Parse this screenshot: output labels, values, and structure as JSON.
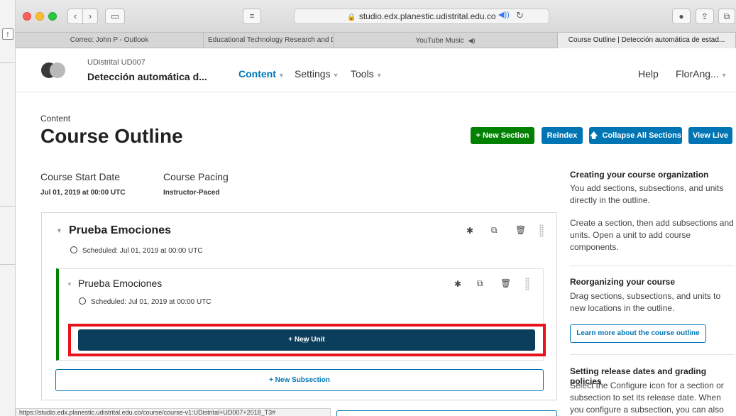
{
  "browser": {
    "url": "studio.edx.planestic.udistrital.edu.co",
    "tabs": [
      {
        "label": "Correo: John P - Outlook",
        "active": false
      },
      {
        "label": "Educational Technology Research and Developme...",
        "active": false
      },
      {
        "label": "YouTube Music",
        "active": false
      },
      {
        "label": "Course Outline | Detección automática de estad...",
        "active": true
      }
    ],
    "status_url": "https://studio.edx.planestic.udistrital.edu.co/course/course-v1:UDistrital+UD007+2018_T3#"
  },
  "header": {
    "course_org": "UDistrital UD007",
    "course_title": "Detección automática d...",
    "nav": {
      "content": "Content",
      "settings": "Settings",
      "tools": "Tools",
      "help": "Help",
      "user": "FlorAng..."
    }
  },
  "page": {
    "subtitle": "Content",
    "title": "Course Outline",
    "actions": {
      "new_section": "+ New Section",
      "reindex": "Reindex",
      "collapse_all": "Collapse All Sections",
      "view_live": "View Live"
    }
  },
  "meta": {
    "start_label": "Course Start Date",
    "start_value": "Jul 01, 2019 at 00:00 UTC",
    "pacing_label": "Course Pacing",
    "pacing_value": "Instructor-Paced"
  },
  "outline": {
    "section": {
      "title": "Prueba Emociones",
      "scheduled": "Scheduled: Jul 01, 2019 at 00:00 UTC"
    },
    "subsection": {
      "title": "Prueba Emociones",
      "scheduled": "Scheduled: Jul 01, 2019 at 00:00 UTC"
    },
    "new_unit": "+  New Unit",
    "new_subsection": "+  New Subsection"
  },
  "sidebar": {
    "h1": "Creating your course organization",
    "p1": "You add sections, subsections, and units directly in the outline.",
    "p2": "Create a section, then add subsections and units. Open a unit to add course components.",
    "h2": "Reorganizing your course",
    "p3": "Drag sections, subsections, and units to new locations in the outline.",
    "learn_more": "Learn more about the course outline",
    "h3": "Setting release dates and grading policies",
    "p4": "Select the Configure icon for a section or subsection to set its release date. When you configure a subsection, you can also"
  },
  "colors": {
    "primary": "#0075b4",
    "success": "#008100",
    "highlight": "#e8141c",
    "dark_button": "#0b3d5c"
  }
}
